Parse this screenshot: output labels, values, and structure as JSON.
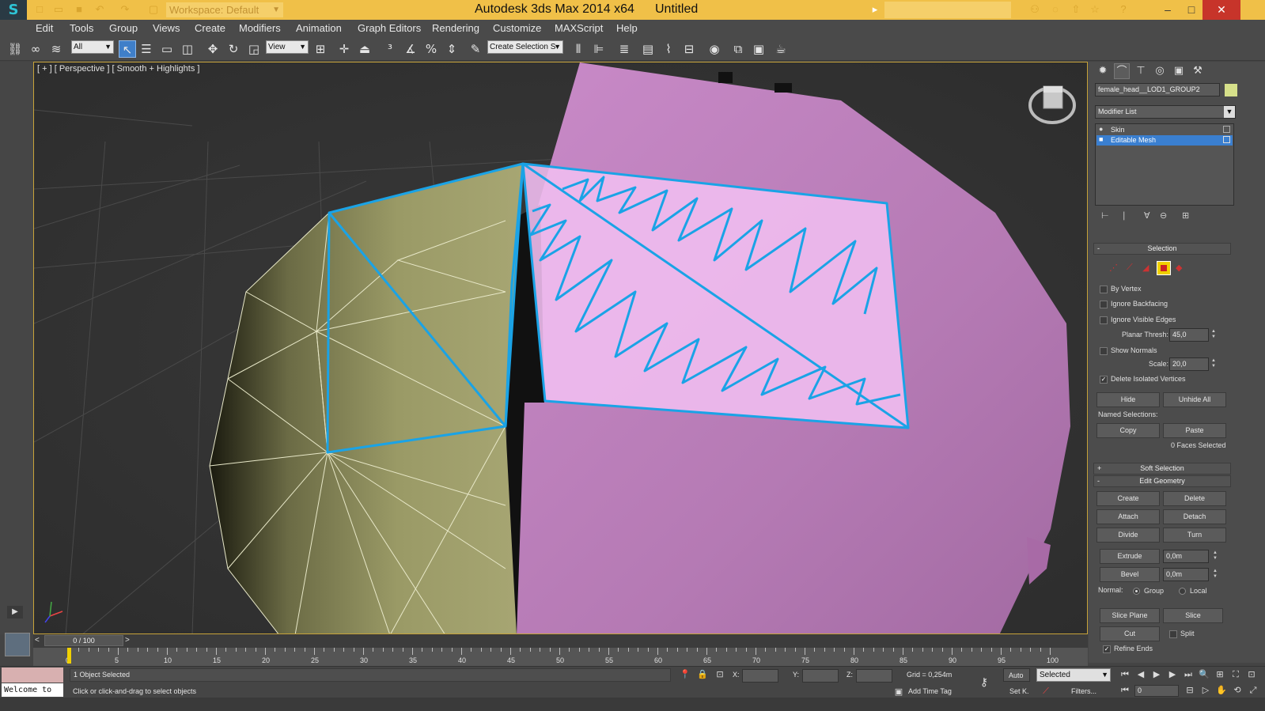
{
  "titlebar": {
    "logo": "S",
    "workspace": "Workspace: Default",
    "app_title": "Autodesk 3ds Max  2014 x64",
    "document": "Untitled",
    "minimize": "–",
    "maximize": "□",
    "close": "✕"
  },
  "menu": [
    "Edit",
    "Tools",
    "Group",
    "Views",
    "Create",
    "Modifiers",
    "Animation",
    "Graph Editors",
    "Rendering",
    "Customize",
    "MAXScript",
    "Help"
  ],
  "toolbar": {
    "filter_value": "All",
    "coord_value": "View",
    "selection_set": "Create Selection S"
  },
  "viewport": {
    "label": "[ + ] [ Perspective ] [ Smooth + Highlights ]"
  },
  "command_panel": {
    "object_name": "female_head__LOD1_GROUP2",
    "object_color": "#d6e08a",
    "modifier_list": "Modifier List",
    "stack": [
      {
        "label": "Skin",
        "selected": false
      },
      {
        "label": "Editable Mesh",
        "selected": true
      }
    ],
    "selection": {
      "title": "Selection",
      "by_vertex": "By Vertex",
      "ignore_backfacing": "Ignore Backfacing",
      "ignore_visible_edges": "Ignore Visible Edges",
      "planar_thresh_label": "Planar Thresh:",
      "planar_thresh_value": "45,0",
      "show_normals": "Show Normals",
      "scale_label": "Scale:",
      "scale_value": "20,0",
      "delete_isolated": "Delete Isolated Vertices",
      "hide": "Hide",
      "unhide_all": "Unhide All",
      "named_selections": "Named Selections:",
      "copy": "Copy",
      "paste": "Paste",
      "faces_selected": "0 Faces Selected"
    },
    "soft_selection": "Soft Selection",
    "edit_geometry": {
      "title": "Edit Geometry",
      "create": "Create",
      "delete": "Delete",
      "attach": "Attach",
      "detach": "Detach",
      "divide": "Divide",
      "turn": "Turn",
      "extrude": "Extrude",
      "extrude_value": "0,0m",
      "bevel": "Bevel",
      "bevel_value": "0,0m",
      "normal_label": "Normal:",
      "group": "Group",
      "local": "Local",
      "slice_plane": "Slice Plane",
      "slice": "Slice",
      "cut": "Cut",
      "split": "Split",
      "refine_ends": "Refine Ends"
    }
  },
  "timeline": {
    "frame": "0 / 100",
    "prev": "<",
    "next": ">",
    "ticks": [
      "0",
      "5",
      "10",
      "15",
      "20",
      "25",
      "30",
      "35",
      "40",
      "45",
      "50",
      "55",
      "60",
      "65",
      "70",
      "75",
      "80",
      "85",
      "90",
      "95",
      "100"
    ]
  },
  "status": {
    "welcome": "Welcome to",
    "objects_selected": "1 Object Selected",
    "prompt": "Click or click-and-drag to select objects",
    "x_label": "X:",
    "y_label": "Y:",
    "z_label": "Z:",
    "grid": "Grid = 0,254m",
    "add_time_tag": "Add Time Tag",
    "auto": "Auto",
    "set_key": "Set K.",
    "selected": "Selected",
    "filters": "Filters...",
    "frame_field": "0"
  }
}
